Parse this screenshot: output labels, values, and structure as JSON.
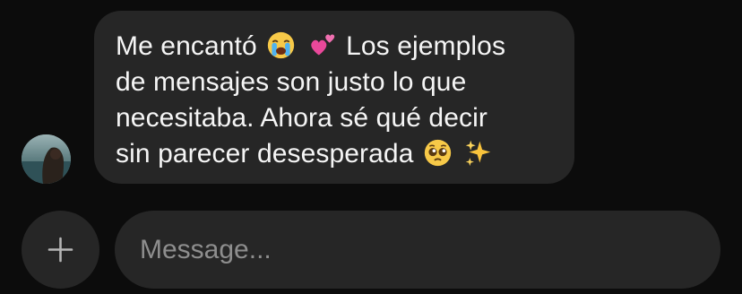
{
  "message": {
    "line1_a": "Me encantó",
    "line1_b": "Los ejemplos",
    "line2": "de mensajes son justo lo que",
    "line3": "necesitaba. Ahora sé qué decir",
    "line4": "sin parecer desesperada",
    "emojis": [
      "loudly-crying-face",
      "two-hearts",
      "pleading-face",
      "sparkles"
    ]
  },
  "composer": {
    "placeholder": "Message...",
    "value": "",
    "add_button_icon": "plus-icon"
  },
  "colors": {
    "background": "#0c0c0c",
    "bubble": "#262626",
    "text": "#f5f5f5",
    "placeholder": "#8e8e8e"
  }
}
